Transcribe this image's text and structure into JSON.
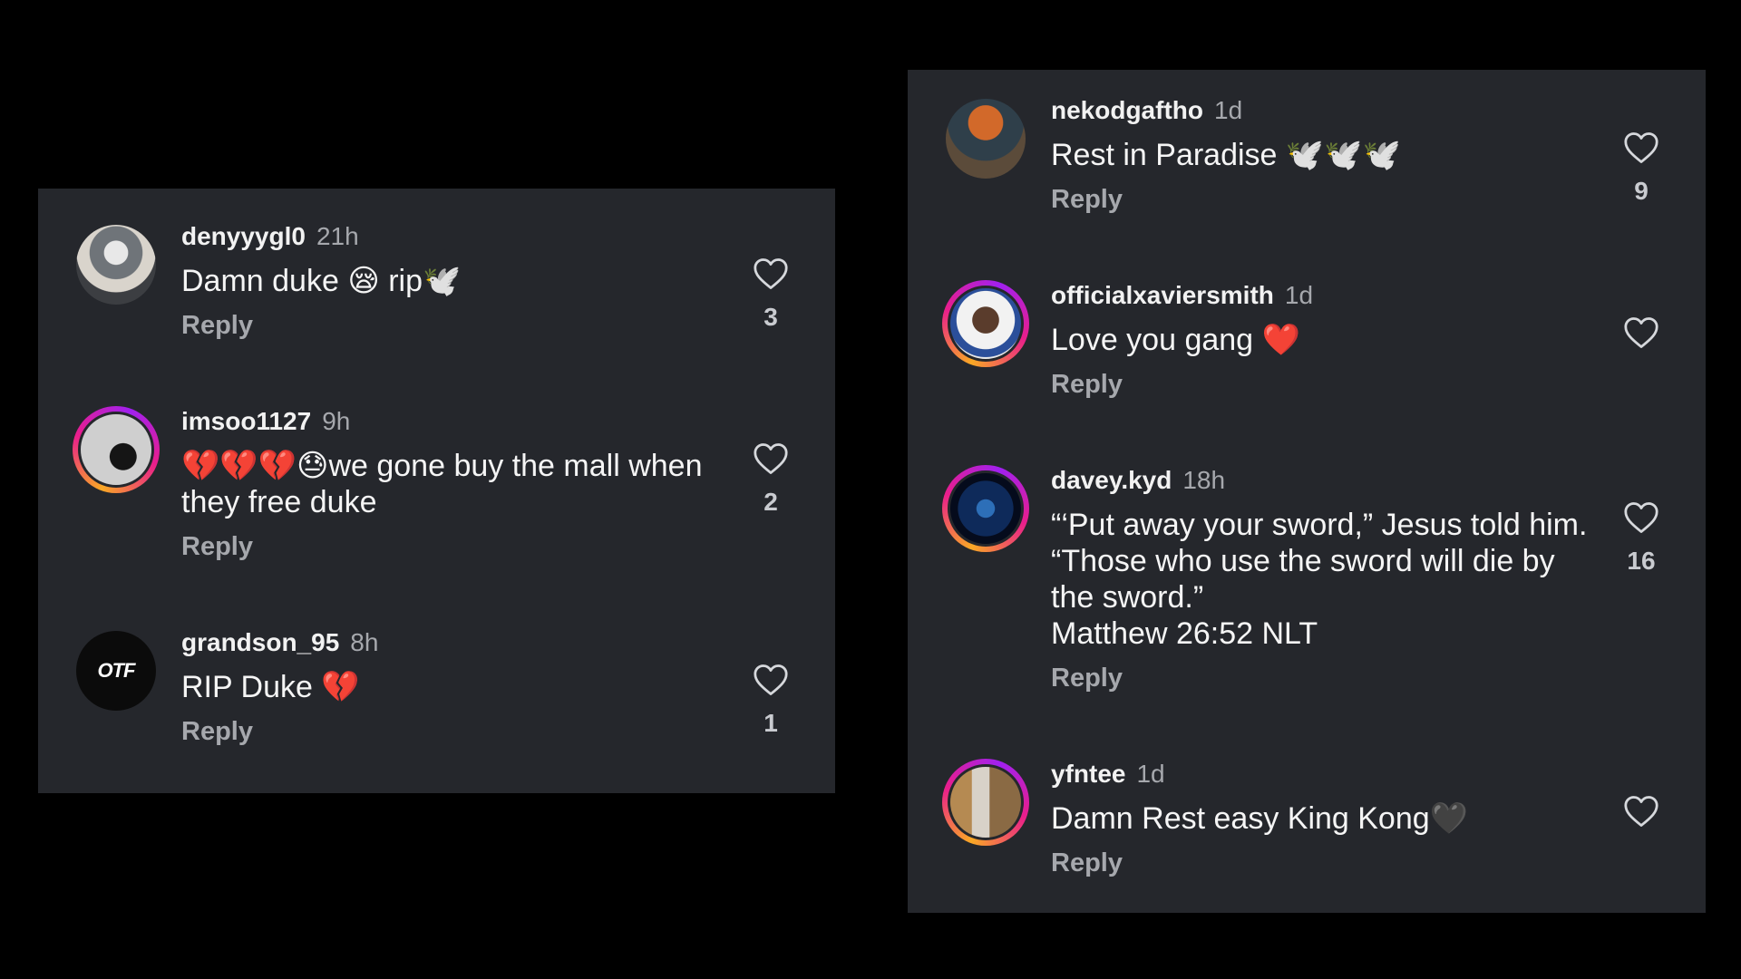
{
  "reply_label": "Reply",
  "left_panel": {
    "comments": [
      {
        "username": "denyyygl0",
        "time": "21h",
        "text": "Damn duke 😪 rip🕊️",
        "likes": "3"
      },
      {
        "username": "imsoo1127",
        "time": "9h",
        "text": "💔💔💔😓we gone buy the mall when they free duke",
        "likes": "2"
      },
      {
        "username": "grandson_95",
        "time": "8h",
        "text": "RIP Duke 💔",
        "likes": "1",
        "avatar_text": "OTF"
      }
    ]
  },
  "right_panel": {
    "comments": [
      {
        "username": "nekodgaftho",
        "time": "1d",
        "text": "Rest in Paradise 🕊️🕊️🕊️",
        "likes": "9"
      },
      {
        "username": "officialxaviersmith",
        "time": "1d",
        "text": "Love you gang ❤️",
        "likes": ""
      },
      {
        "username": "davey.kyd",
        "time": "18h",
        "text": "“‘Put away your sword,” Jesus told him. “Those who use the sword will die by the sword.”",
        "text_line2": "Matthew 26:52 NLT",
        "likes": "16"
      },
      {
        "username": "yfntee",
        "time": "1d",
        "text": "Damn Rest easy King Kong🖤",
        "likes": ""
      }
    ]
  },
  "colors": {
    "background": "#000000",
    "panel": "#25272c",
    "secondary_text": "#a6a8ad",
    "story_ring": [
      "#f9a825",
      "#e91e8c",
      "#a020f0"
    ]
  },
  "icons": [
    "heart-outline-icon"
  ]
}
